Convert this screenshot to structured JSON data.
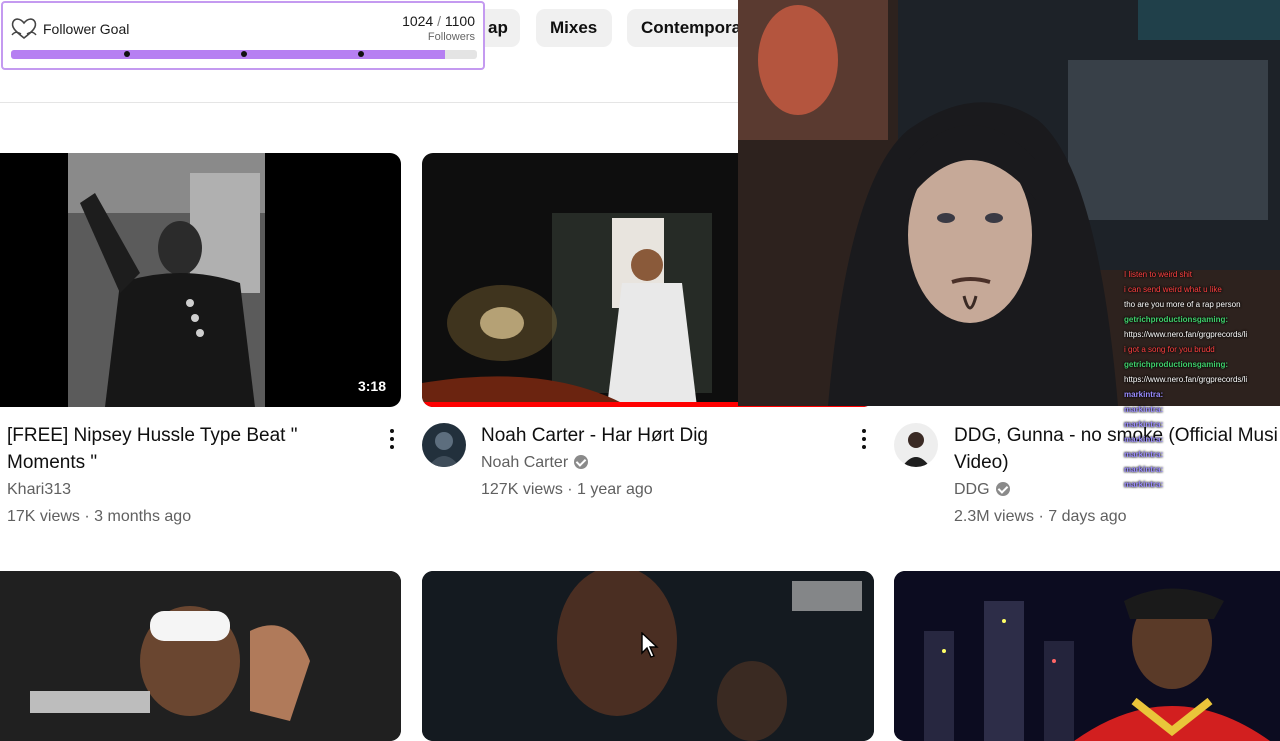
{
  "follower_goal": {
    "title": "Follower Goal",
    "current": "1024",
    "separator": "/",
    "target": "1100",
    "unit": "Followers",
    "progress_fraction": 0.931,
    "icon": "heart-hands-icon"
  },
  "chips": [
    {
      "label": "ap"
    },
    {
      "label": "Mixes"
    },
    {
      "label": "Contempora"
    }
  ],
  "videos": [
    {
      "title": "[FREE] Nipsey Hussle Type Beat \" Moments \"",
      "channel": "Khari313",
      "meta": "17K views · 3 months ago",
      "duration": "3:18"
    },
    {
      "title": "Noah Carter - Har Hørt Dig",
      "channel": "Noah Carter",
      "meta": "127K views · 1 year ago",
      "verified": true,
      "watched_fraction": 1.0
    },
    {
      "title": "DDG, Gunna - no smoke (Official Music Video)",
      "title_line1": "DDG, Gunna - no smoke (Official Musi",
      "title_line2": "Video)",
      "channel": "DDG",
      "meta": "2.3M views · 7 days ago",
      "verified": true
    }
  ],
  "chat": [
    {
      "user": "",
      "text": "I listen to weird shit",
      "color": "#ff4040"
    },
    {
      "user": "",
      "text": "i can send weird what u like",
      "color": "#ff4040"
    },
    {
      "user": "",
      "text": "tho are you more of a rap person",
      "color": "#ffffff"
    },
    {
      "user": "getrichproductionsgaming:",
      "text": "",
      "color": "#3fd06b"
    },
    {
      "user": "",
      "text": "https://www.nero.fan/grgprecords/li",
      "color": "#ffffff"
    },
    {
      "user": "",
      "text": "i got a song for you brudd",
      "color": "#ff4040"
    },
    {
      "user": "getrichproductionsgaming:",
      "text": "",
      "color": "#3fd06b"
    },
    {
      "user": "",
      "text": "https://www.nero.fan/grgprecords/li",
      "color": "#ffffff"
    },
    {
      "user": "markintra:",
      "text": "",
      "color": "#9a8cff"
    },
    {
      "user": "markintra:",
      "text": "",
      "color": "#9a8cff"
    },
    {
      "user": "markintra:",
      "text": "",
      "color": "#9a8cff"
    },
    {
      "user": "markintra:",
      "text": "",
      "color": "#9a8cff"
    },
    {
      "user": "markintra:",
      "text": "",
      "color": "#9a8cff"
    },
    {
      "user": "markintra:",
      "text": "",
      "color": "#9a8cff"
    },
    {
      "user": "markintra:",
      "text": "",
      "color": "#9a8cff"
    }
  ],
  "colors": {
    "goal_border": "#c49af0",
    "goal_fill": "#b67ff2",
    "youtube_red": "#ff0000",
    "text_secondary": "#606060"
  }
}
